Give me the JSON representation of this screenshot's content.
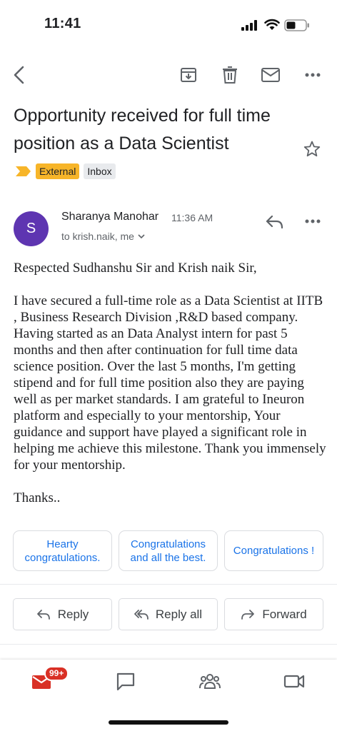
{
  "status_bar": {
    "time": "11:41"
  },
  "toolbar": {
    "back": "back-icon",
    "archive": "archive-icon",
    "delete": "trash-icon",
    "mark_unread": "mail-icon",
    "more": "more-icon"
  },
  "email": {
    "subject": "Opportunity received for full time position as a Data Scientist",
    "labels": [
      "External",
      "Inbox"
    ],
    "sender": {
      "initial": "S",
      "name": "Sharanya Manohar",
      "time": "11:36 AM",
      "recipients": "to krish.naik, me"
    },
    "body": {
      "greeting": "Respected Sudhanshu Sir and Krish naik Sir,",
      "paragraph": "I have secured a full-time role as a Data Scientist at IITB , Business Research Division ,R&D based company. Having started as an Data Analyst intern for past 5 months and then after continuation for full time data science position. Over the last 5 months, I'm getting stipend and for full time position also they are paying well as per market standards. I am grateful to Ineuron platform and especially to your mentorship, Your guidance and support have played a significant role in helping me achieve this milestone. Thank you immensely for your mentorship.",
      "closing": "Thanks.."
    }
  },
  "smart_replies": [
    "Hearty congratulations.",
    "Congratulations and all the best.",
    "Congratulations !"
  ],
  "actions": {
    "reply": "Reply",
    "reply_all": "Reply all",
    "forward": "Forward"
  },
  "bottom_nav": {
    "mail_badge": "99+",
    "items": [
      "mail-icon",
      "chat-icon",
      "spaces-icon",
      "meet-icon"
    ]
  },
  "colors": {
    "avatar": "#5e35b1",
    "external_label": "#f7b529",
    "link_blue": "#1a73e8",
    "badge_red": "#d93025"
  }
}
